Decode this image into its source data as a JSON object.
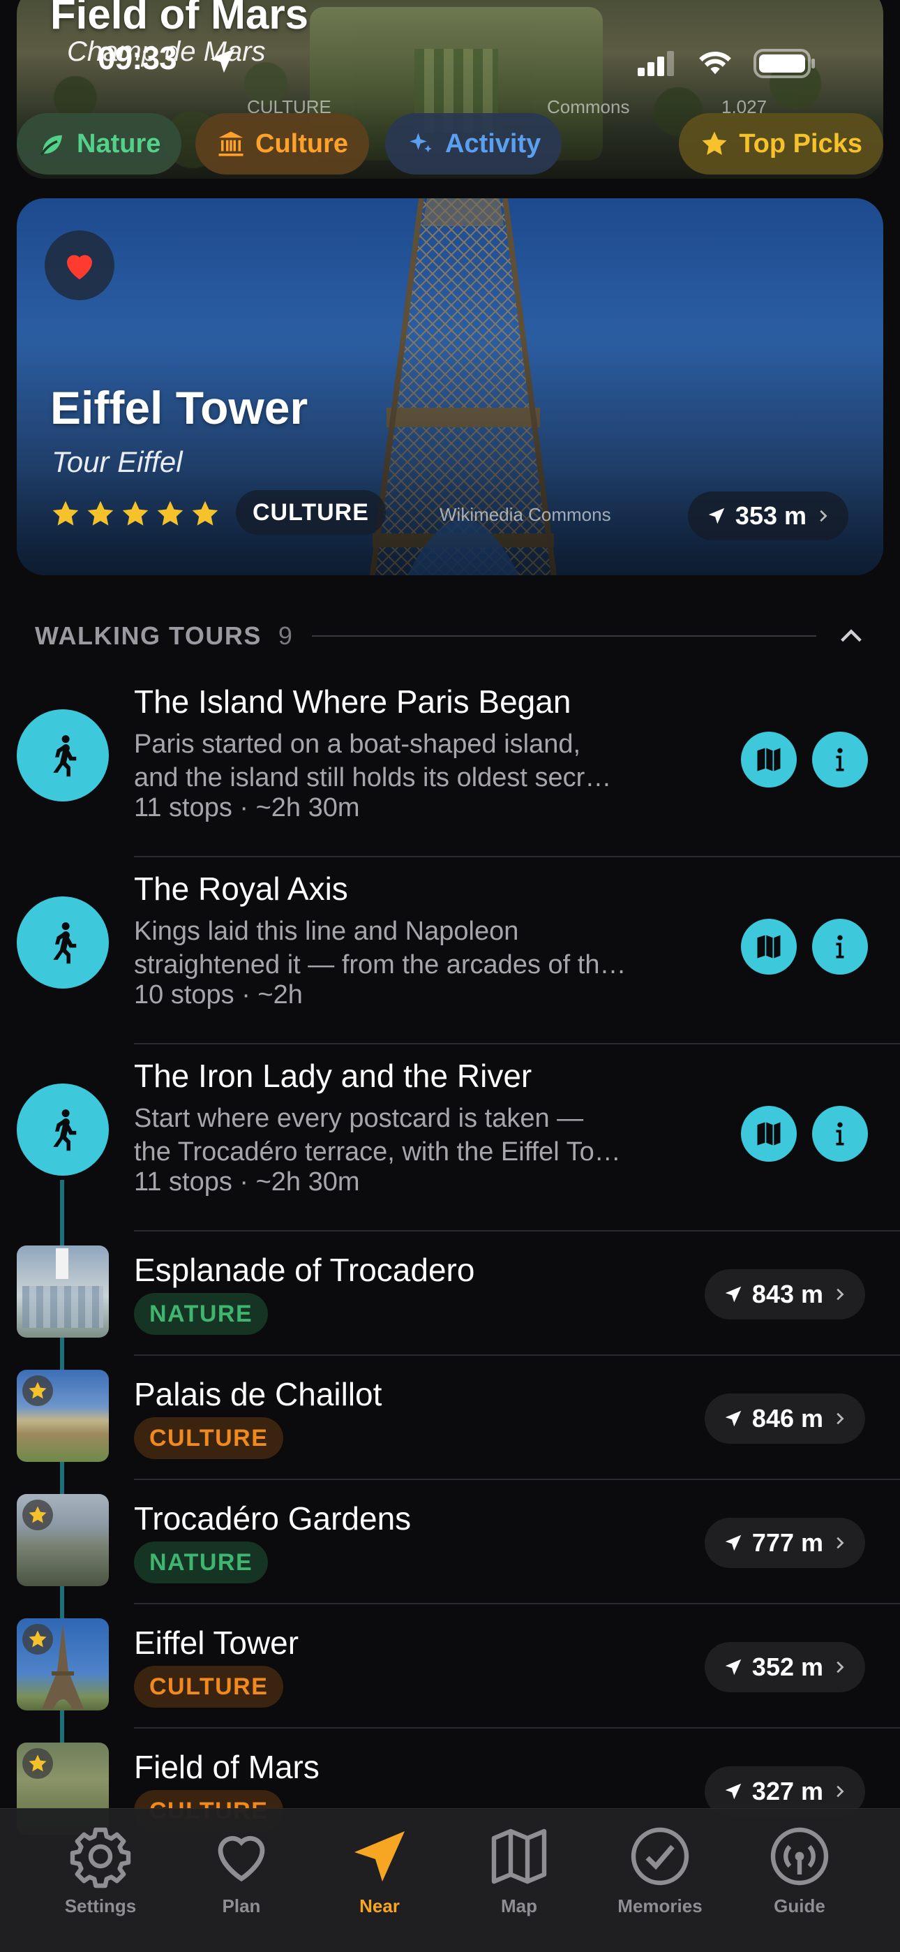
{
  "status_bar": {
    "time": "09:33"
  },
  "top_card": {
    "title": "Field of Mars",
    "subtitle": "Champ de Mars",
    "ghost_category": "CULTURE",
    "ghost_credit": "Commons",
    "ghost_distance": "1,027"
  },
  "filters": [
    {
      "label": "Nature",
      "icon": "leaf-icon"
    },
    {
      "label": "Culture",
      "icon": "museum-icon"
    },
    {
      "label": "Activity",
      "icon": "sparkle-icon"
    },
    {
      "label": "Top Picks",
      "icon": "star-icon"
    }
  ],
  "featured": {
    "title": "Eiffel Tower",
    "subtitle": "Tour Eiffel",
    "rating": 5,
    "category": "CULTURE",
    "credit": "Wikimedia Commons",
    "distance": "353 m",
    "favorited": true
  },
  "walking_tours": {
    "header": "WALKING TOURS",
    "count": "9",
    "tours": [
      {
        "title": "The Island Where Paris Began",
        "desc_line1": "Paris started on a boat-shaped island,",
        "desc_line2": "and the island still holds its oldest secr…",
        "meta": "11 stops · ~2h 30m"
      },
      {
        "title": "The Royal Axis",
        "desc_line1": "Kings laid this line and Napoleon",
        "desc_line2": "straightened it — from the arcades of th…",
        "meta": "10 stops · ~2h"
      },
      {
        "title": "The Iron Lady and the River",
        "desc_line1": "Start where every postcard is taken —",
        "desc_line2": "the Trocadéro terrace, with the Eiffel To…",
        "meta": "11 stops · ~2h 30m"
      }
    ]
  },
  "places": [
    {
      "title": "Esplanade of Trocadero",
      "tag": "NATURE",
      "distance": "843 m",
      "starred": false
    },
    {
      "title": "Palais de Chaillot",
      "tag": "CULTURE",
      "distance": "846 m",
      "starred": true
    },
    {
      "title": "Trocadéro Gardens",
      "tag": "NATURE",
      "distance": "777 m",
      "starred": true
    },
    {
      "title": "Eiffel Tower",
      "tag": "CULTURE",
      "distance": "352 m",
      "starred": true
    },
    {
      "title": "Field of Mars",
      "tag": "CULTURE",
      "distance": "327 m",
      "starred": true
    }
  ],
  "tabbar": [
    {
      "label": "Settings",
      "icon": "gear-icon",
      "active": false
    },
    {
      "label": "Plan",
      "icon": "heart-icon",
      "active": false
    },
    {
      "label": "Near",
      "icon": "location-arrow-icon",
      "active": true
    },
    {
      "label": "Map",
      "icon": "map-icon",
      "active": false
    },
    {
      "label": "Memories",
      "icon": "checkmark-circle-icon",
      "active": false
    },
    {
      "label": "Guide",
      "icon": "broadcast-icon",
      "active": false
    }
  ],
  "colors": {
    "accent_teal": "#3dc8dc",
    "accent_orange": "#f6a623",
    "nature_green": "#3fb56f",
    "culture_orange": "#f08a1e",
    "star_yellow": "#f6c22c"
  }
}
